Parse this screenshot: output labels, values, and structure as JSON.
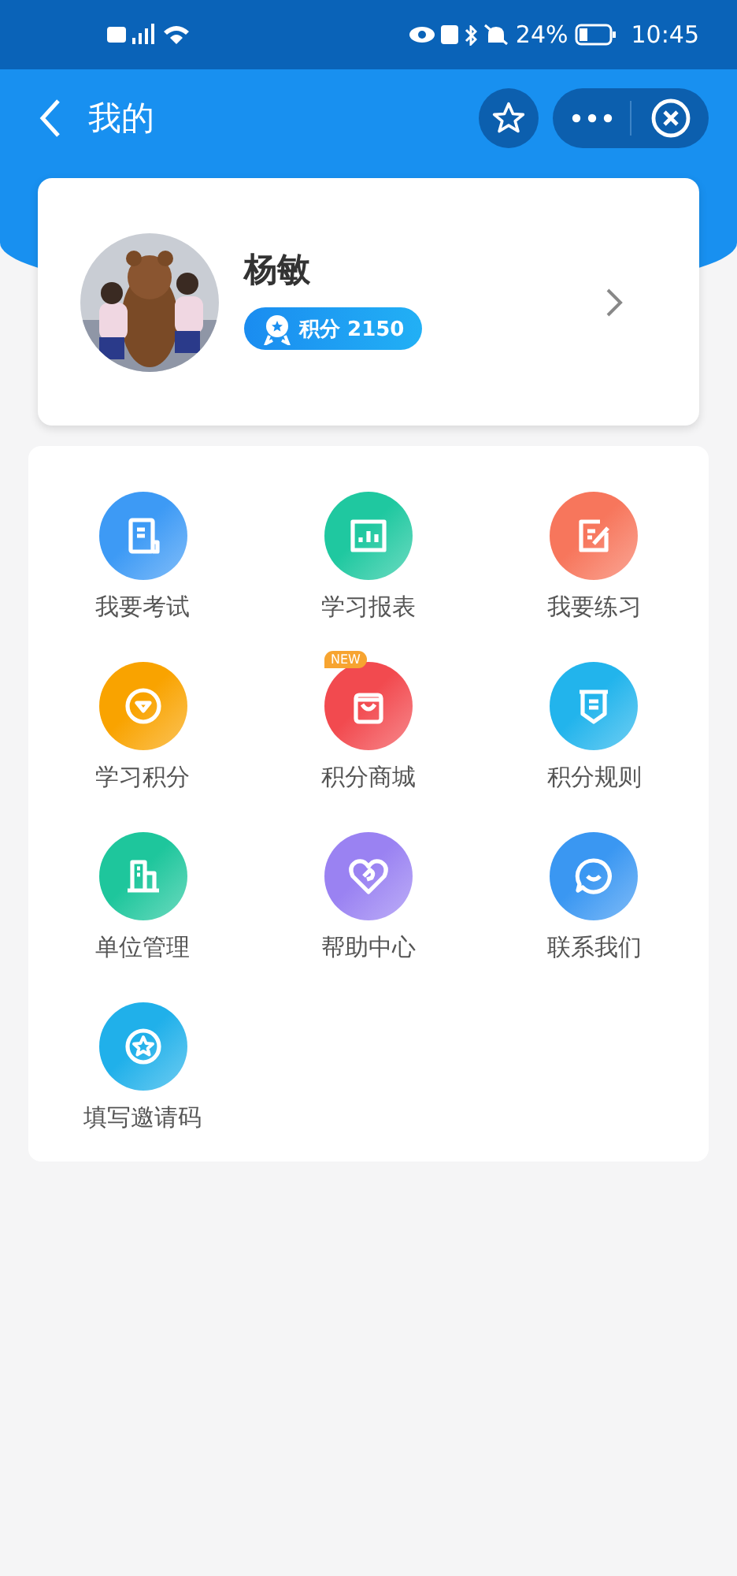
{
  "status_bar": {
    "battery": "24%",
    "time": "10:45"
  },
  "nav": {
    "title": "我的"
  },
  "profile": {
    "name": "杨敏",
    "points": "积分 2150"
  },
  "menu": [
    {
      "label": "我要考试",
      "kind": "document",
      "color": "#3d9af5"
    },
    {
      "label": "学习报表",
      "kind": "chart",
      "color": "#1fc8a0"
    },
    {
      "label": "我要练习",
      "kind": "edit",
      "color": "#f7765c"
    },
    {
      "label": "学习积分",
      "kind": "gem",
      "color": "#f9a300"
    },
    {
      "label": "积分商城",
      "kind": "bag",
      "color": "#f24a4f",
      "badge": "NEW"
    },
    {
      "label": "积分规则",
      "kind": "rules",
      "color": "#22b4ec"
    },
    {
      "label": "单位管理",
      "kind": "building",
      "color": "#1ec69c"
    },
    {
      "label": "帮助中心",
      "kind": "heart",
      "color": "#9a82f2"
    },
    {
      "label": "联系我们",
      "kind": "chat",
      "color": "#3a97f2"
    },
    {
      "label": "填写邀请码",
      "kind": "star",
      "color": "#20b0ea"
    }
  ]
}
